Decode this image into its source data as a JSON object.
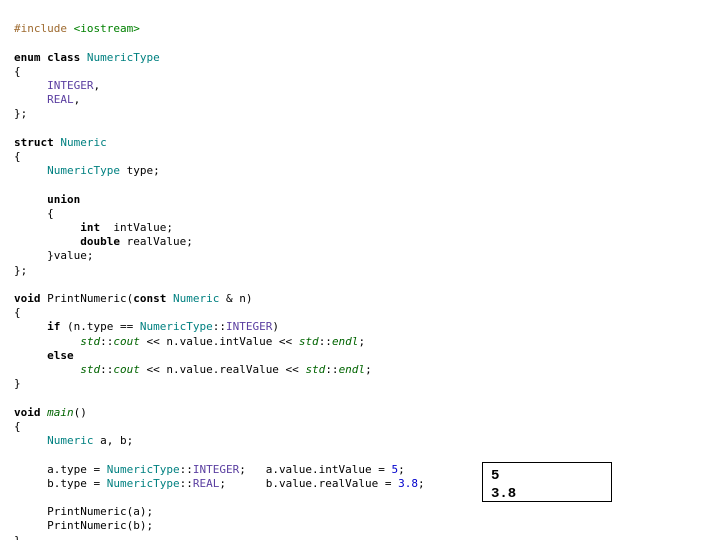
{
  "code": {
    "l1": {
      "a": "#include ",
      "b": "<iostream>"
    },
    "l3": {
      "a": "enum class ",
      "b": "NumericType"
    },
    "l4": "{",
    "l5": {
      "a": "INTEGER",
      "b": ","
    },
    "l6": {
      "a": "REAL",
      "b": ","
    },
    "l7": "};",
    "l9": {
      "a": "struct ",
      "b": "Numeric"
    },
    "l10": "{",
    "l11": {
      "a": "NumericType",
      "b": " type;"
    },
    "l13": "union",
    "l14": "{",
    "l15": {
      "a": "int",
      "b": "  intValue;"
    },
    "l16": {
      "a": "double",
      "b": " realValue;"
    },
    "l17": "}value;",
    "l18": "};",
    "l20": {
      "a": "void",
      "b": " PrintNumeric(",
      "c": "const ",
      "d": "Numeric",
      "e": " & n)"
    },
    "l21": "{",
    "l22": {
      "a": "if",
      "b": " (n.type == ",
      "c": "NumericType",
      "d": "::",
      "e": "INTEGER",
      "f": ")"
    },
    "l23": {
      "a": "std",
      "b": "::",
      "c": "cout",
      "d": " << n.value.intValue << ",
      "e": "std",
      "f": "::",
      "g": "endl",
      "h": ";"
    },
    "l24": "else",
    "l25": {
      "a": "std",
      "b": "::",
      "c": "cout",
      "d": " << n.value.realValue << ",
      "e": "std",
      "f": "::",
      "g": "endl",
      "h": ";"
    },
    "l26": "}",
    "l28": {
      "a": "void ",
      "b": "main",
      "c": "()"
    },
    "l29": "{",
    "l30": {
      "a": "Numeric",
      "b": " a, b;"
    },
    "l32": {
      "a": "a.type = ",
      "b": "NumericType",
      "c": "::",
      "d": "INTEGER",
      "e": ";   a.value.intValue = ",
      "f": "5",
      "g": ";"
    },
    "l33": {
      "a": "b.type = ",
      "b": "NumericType",
      "c": "::",
      "d": "REAL",
      "e": ";      b.value.realValue = ",
      "f": "3.8",
      "g": ";"
    },
    "l35": "PrintNumeric(a);",
    "l36": "PrintNumeric(b);",
    "l37": "}"
  },
  "output": {
    "line1": "5",
    "line2": "3.8"
  }
}
